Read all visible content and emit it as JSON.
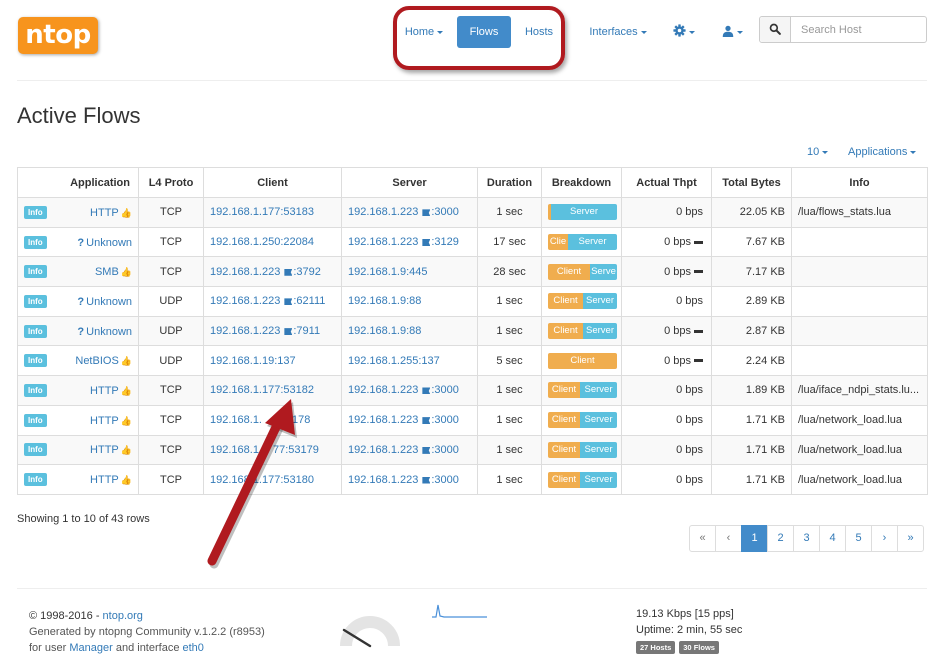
{
  "nav": {
    "logo": "ntop",
    "home": "Home",
    "flows": "Flows",
    "hosts": "Hosts",
    "interfaces": "Interfaces",
    "search_placeholder": "Search Host"
  },
  "page": {
    "title": "Active Flows",
    "per_page": "10",
    "applications": "Applications"
  },
  "table": {
    "headers": [
      "Application",
      "L4 Proto",
      "Client",
      "Server",
      "Duration",
      "Breakdown",
      "Actual Thpt",
      "Total Bytes",
      "Info"
    ],
    "rows": [
      {
        "badge": "Info",
        "app": "HTTP",
        "proto": "TCP",
        "client": "192.168.1.177:53183",
        "server": "192.168.1.223",
        "server_port": ":3000",
        "duration": "1 sec",
        "bd_client": "",
        "bd_server": "Server",
        "thpt": "0 bps",
        "bytes": "22.05 KB",
        "info": "/lua/flows_stats.lua"
      },
      {
        "badge": "Info",
        "app": "Unknown",
        "proto": "TCP",
        "client": "192.168.1.250:22084",
        "server": "192.168.1.223",
        "server_port": ":3129",
        "duration": "17 sec",
        "bd_client": "Clie",
        "bd_server": "Server",
        "thpt": "0 bps",
        "bytes": "7.67 KB",
        "info": ""
      },
      {
        "badge": "Info",
        "app": "SMB",
        "proto": "TCP",
        "client": "192.168.1.223",
        "client_port": ":3792",
        "server": "192.168.1.9:445",
        "duration": "28 sec",
        "bd_client": "Client",
        "bd_server": "Serve",
        "thpt": "0 bps",
        "bytes": "7.17 KB",
        "info": ""
      },
      {
        "badge": "Info",
        "app": "Unknown",
        "proto": "UDP",
        "client": "192.168.1.223",
        "client_port": ":62111",
        "server": "192.168.1.9:88",
        "duration": "1 sec",
        "bd_client": "Client",
        "bd_server": "Server",
        "thpt": "0 bps",
        "bytes": "2.89 KB",
        "info": ""
      },
      {
        "badge": "Info",
        "app": "Unknown",
        "proto": "UDP",
        "client": "192.168.1.223",
        "client_port": ":7911",
        "server": "192.168.1.9:88",
        "duration": "1 sec",
        "bd_client": "Client",
        "bd_server": "Server",
        "thpt": "0 bps",
        "bytes": "2.87 KB",
        "info": ""
      },
      {
        "badge": "Info",
        "app": "NetBIOS",
        "proto": "UDP",
        "client": "192.168.1.19:137",
        "server": "192.168.1.255:137",
        "duration": "5 sec",
        "bd_client": "Client",
        "bd_server": "",
        "thpt": "0 bps",
        "bytes": "2.24 KB",
        "info": ""
      },
      {
        "badge": "Info",
        "app": "HTTP",
        "proto": "TCP",
        "client": "192.168.1.177:53182",
        "server": "192.168.1.223",
        "server_port": ":3000",
        "duration": "1 sec",
        "bd_client": "Client",
        "bd_server": "Server",
        "thpt": "0 bps",
        "bytes": "1.89 KB",
        "info": "/lua/iface_ndpi_stats.lu..."
      },
      {
        "badge": "Info",
        "app": "HTTP",
        "proto": "TCP",
        "client": "192.168.1.",
        "client_tail": "178",
        "server": "192.168.1.223",
        "server_port": ":3000",
        "duration": "1 sec",
        "bd_client": "Client",
        "bd_server": "Server",
        "thpt": "0 bps",
        "bytes": "1.71 KB",
        "info": "/lua/network_load.lua"
      },
      {
        "badge": "Info",
        "app": "HTTP",
        "proto": "TCP",
        "client": "192.168.1.",
        "client_tail": "77:53179",
        "server": "192.168.1.223",
        "server_port": ":3000",
        "duration": "1 sec",
        "bd_client": "Client",
        "bd_server": "Server",
        "thpt": "0 bps",
        "bytes": "1.71 KB",
        "info": "/lua/network_load.lua"
      },
      {
        "badge": "Info",
        "app": "HTTP",
        "proto": "TCP",
        "client": "192.168.1.177:53180",
        "server": "192.168.1.223",
        "server_port": ":3000",
        "duration": "1 sec",
        "bd_client": "Client",
        "bd_server": "Server",
        "thpt": "0 bps",
        "bytes": "1.71 KB",
        "info": "/lua/network_load.lua"
      }
    ]
  },
  "pagination": {
    "showing": "Showing 1 to 10 of 43 rows",
    "pages": [
      "«",
      "‹",
      "1",
      "2",
      "3",
      "4",
      "5",
      "›",
      "»"
    ],
    "active": "1"
  },
  "footer": {
    "copyright": "© 1998-2016 - ",
    "site": "ntop.org",
    "generated": "Generated by ntopng Community v.1.2.2 (r8953)",
    "for_user": "for user ",
    "user": "Manager",
    "and_interface": " and interface ",
    "iface": "eth0",
    "throughput": "19.13 Kbps [15 pps]",
    "uptime": "Uptime: 2 min, 55 sec",
    "hosts_badge": "27 Hosts",
    "flows_badge": "30 Flows"
  },
  "colors": {
    "accent": "#428bca",
    "link": "#337ab7",
    "client_bar": "#f0ad4e",
    "server_bar": "#5bc0de",
    "highlight": "#b01a1f",
    "logo": "#f7941d"
  }
}
